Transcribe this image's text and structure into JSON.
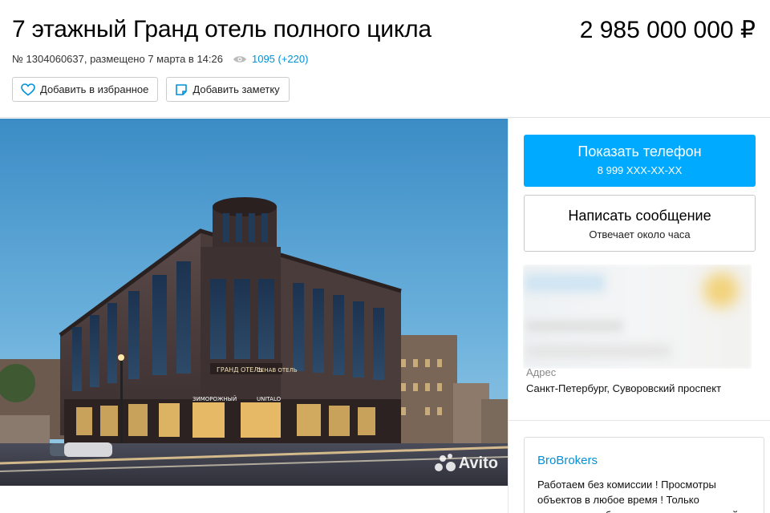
{
  "listing": {
    "title": "7 этажный Гранд отель полного цикла",
    "price": "2 985 000 000 ₽",
    "meta": "№ 1304060637, размещено 7 марта в 14:26",
    "views": "1095 (+220)"
  },
  "actions": {
    "favorite_label": "Добавить в избранное",
    "note_label": "Добавить заметку"
  },
  "photo": {
    "watermark": "Avito",
    "sign_text": "ГРАНД ОТЕЛЬ",
    "sign_text_right": "CЕНАВ ОТЕЛЬ",
    "store_left": "ЗИМОРОЖНЫЙ",
    "store_right": "UNITALO"
  },
  "contact": {
    "phone_label": "Показать телефон",
    "phone_number": "8 999 XXX-XX-XX",
    "message_label": "Написать сообщение",
    "message_sub": "Отвечает около часа"
  },
  "address": {
    "label": "Адрес",
    "value": "Санкт-Петербург, Суворовский проспект"
  },
  "ad": {
    "name": "BroBrokers",
    "text": "Работаем без комиссии ! Просмотры объектов в любое время ! Только проверенные бизнесы с подтвержденной"
  },
  "colors": {
    "accent": "#00aaff",
    "link": "#0091d9",
    "border": "#cccccc"
  },
  "icons": [
    "eye-icon",
    "heart-icon",
    "note-icon",
    "avito-logo-icon"
  ]
}
